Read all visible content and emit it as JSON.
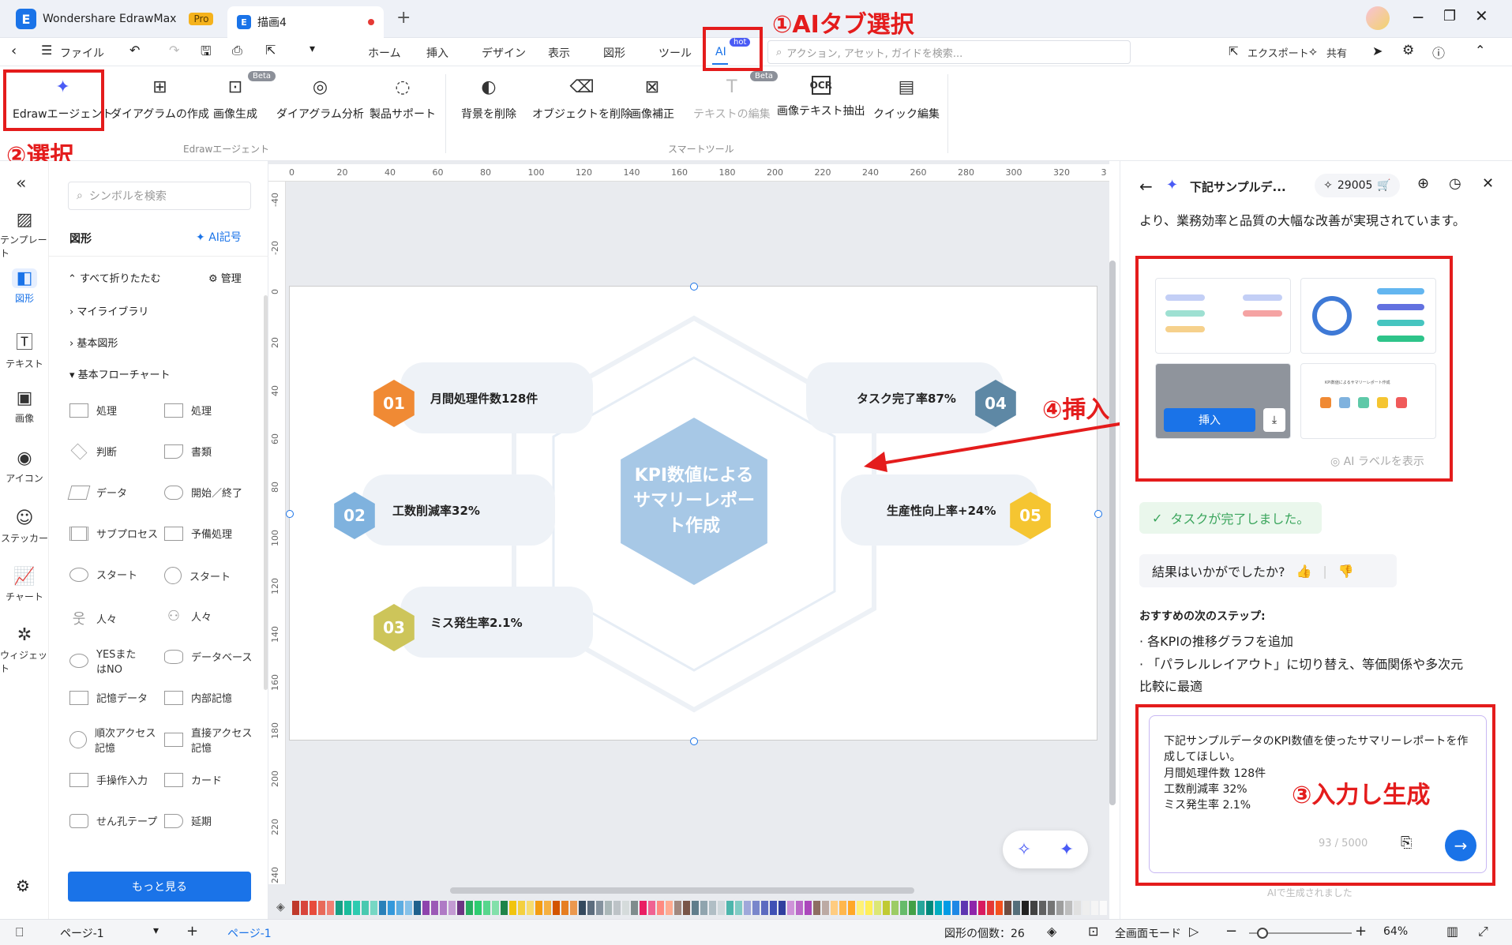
{
  "titlebar": {
    "app_name": "Wondershare EdrawMax",
    "pro_badge": "Pro",
    "doc_tab": "描画4",
    "new_tab": "+"
  },
  "menubar": {
    "file": "ファイル",
    "tabs": [
      "ホーム",
      "挿入",
      "デザイン",
      "表示",
      "図形",
      "ツール"
    ],
    "ai_tab": "AI",
    "hot_badge": "hot",
    "search_placeholder": "アクション, アセット, ガイドを検索...",
    "export": "エクスポート",
    "share": "共有"
  },
  "ribbon": {
    "edraw_agent": "Edrawエージェント",
    "diagram_create": "ダイアグラムの作成",
    "image_gen": "画像生成",
    "diagram_analysis": "ダイアグラム分析",
    "product_support": "製品サポート",
    "group1_label": "Edrawエージェント",
    "remove_bg": "背景を削除",
    "remove_object": "オブジェクトを削除",
    "image_fix": "画像補正",
    "text_edit": "テキストの編集",
    "ocr": "画像テキスト抽出",
    "quick_edit": "クイック編集",
    "group2_label": "スマートツール",
    "beta": "Beta"
  },
  "annotations": {
    "step1": "①AIタブ選択",
    "step2": "②選択",
    "step3": "③入力し生成",
    "step4": "④挿入"
  },
  "leftbar": [
    "テンプレート",
    "図形",
    "テキスト",
    "画像",
    "アイコン",
    "ステッカー",
    "チャート",
    "ウィジェット"
  ],
  "symbols": {
    "search_placeholder": "シンボルを検索",
    "section": "図形",
    "ai_symbol": "AI記号",
    "collapse_all": "すべて折りたたむ",
    "manage": "管理",
    "my_library": "マイライブラリ",
    "basic_shapes": "基本図形",
    "basic_flowchart": "基本フローチャート",
    "shapes": [
      "処理",
      "処理",
      "判断",
      "書類",
      "データ",
      "開始／終了",
      "サブプロセス",
      "予備処理",
      "スタート",
      "スタート",
      "人々",
      "人々",
      "YESまたはNO",
      "データベース",
      "記憶データ",
      "内部記憶",
      "順次アクセス記憶",
      "直接アクセス記憶",
      "手操作入力",
      "カード",
      "せん孔テープ",
      "延期"
    ],
    "more_button": "もっと見る"
  },
  "ruler_top": [
    "0",
    "20",
    "40",
    "60",
    "80",
    "100",
    "120",
    "140",
    "160",
    "180",
    "200",
    "220",
    "240",
    "260",
    "280",
    "300",
    "320",
    "3"
  ],
  "ruler_left": [
    "-40",
    "-20",
    "0",
    "20",
    "40",
    "60",
    "80",
    "100",
    "120",
    "140",
    "160",
    "180",
    "200",
    "220",
    "240"
  ],
  "diagram": {
    "center": "KPI数値によるサマリーレポート作成",
    "items": [
      {
        "num": "01",
        "label": "月間処理件数128件",
        "color": "#f08a34"
      },
      {
        "num": "02",
        "label": "工数削減率32%",
        "color": "#7fb2de"
      },
      {
        "num": "03",
        "label": "ミス発生率2.1%",
        "color": "#cdc55a"
      },
      {
        "num": "04",
        "label": "タスク完了率87%",
        "color": "#5e88a5"
      },
      {
        "num": "05",
        "label": "生産性向上率+24%",
        "color": "#f5c531"
      }
    ]
  },
  "rightpanel": {
    "title": "下記サンプルデ...",
    "credits": "29005",
    "intro_text": "より、業務効率と品質の大幅な改善が実現されています。",
    "insert_button": "挿入",
    "thumb_title": "KPI数値によるサマリーレポート作成",
    "ai_label": "AI ラベルを表示",
    "task_done": "タスクが完了しました。",
    "feedback_q": "結果はいかがでしたか?",
    "next_steps_title": "おすすめの次のステップ:",
    "next_step_1": "· 各KPIの推移グラフを追加",
    "next_step_2": "· 「パラレルレイアウト」に切り替え、等価関係や多次元比較に最適",
    "input_text": "下記サンプルデータのKPI数値を使ったサマリーレポートを作成してほしい。\n月間処理件数 128件\n工数削減率 32%\nミス発生率 2.1%",
    "char_count": "93 / 5000",
    "footer": "AIで生成されました"
  },
  "bottombar": {
    "page_select": "ページ-1",
    "page_tab": "ページ-1",
    "shape_count": "図形の個数：26",
    "fullscreen": "全画面モード",
    "zoom": "64%"
  },
  "palette": [
    "#c0392b",
    "#d8453c",
    "#e74c3c",
    "#e86a5a",
    "#f08074",
    "#16a085",
    "#1abc9c",
    "#2dcbb0",
    "#48c9b0",
    "#76d7c4",
    "#2980b9",
    "#3498db",
    "#5dade2",
    "#85c1e9",
    "#1f618d",
    "#8e44ad",
    "#9b59b6",
    "#af7ac5",
    "#c39bd3",
    "#6c3483",
    "#27ae60",
    "#2ecc71",
    "#58d68d",
    "#82e0aa",
    "#1e8449",
    "#f1c40f",
    "#f4d03f",
    "#f7dc6f",
    "#f39c12",
    "#f5b041",
    "#d35400",
    "#e67e22",
    "#eb984e",
    "#34495e",
    "#5d6d7e",
    "#85929e",
    "#aab7b8",
    "#bdc3c7",
    "#d5dbdb",
    "#7f8c8d",
    "#e91e63",
    "#f06292",
    "#ff8a80",
    "#ffab91",
    "#a1887f",
    "#795548",
    "#607d8b",
    "#90a4ae",
    "#b0bec5",
    "#cfd8dc",
    "#4db6ac",
    "#80cbc4",
    "#9fa8da",
    "#7986cb",
    "#5c6bc0",
    "#3f51b5",
    "#303f9f",
    "#ce93d8",
    "#ba68c8",
    "#ab47bc",
    "#8d6e63",
    "#bcaaa4",
    "#ffcc80",
    "#ffb74d",
    "#ffa726",
    "#fff176",
    "#ffee58",
    "#dce775",
    "#c0ca33",
    "#9ccc65",
    "#66bb6a",
    "#43a047",
    "#26a69a",
    "#00897b",
    "#00acc1",
    "#039be5",
    "#1e88e5",
    "#5e35b1",
    "#8e24aa",
    "#d81b60",
    "#e53935",
    "#f4511e",
    "#6d4c41",
    "#546e7a",
    "#212121",
    "#424242",
    "#616161",
    "#757575",
    "#9e9e9e",
    "#bdbdbd",
    "#e0e0e0",
    "#eeeeee",
    "#f5f5f5",
    "#fafafa"
  ]
}
